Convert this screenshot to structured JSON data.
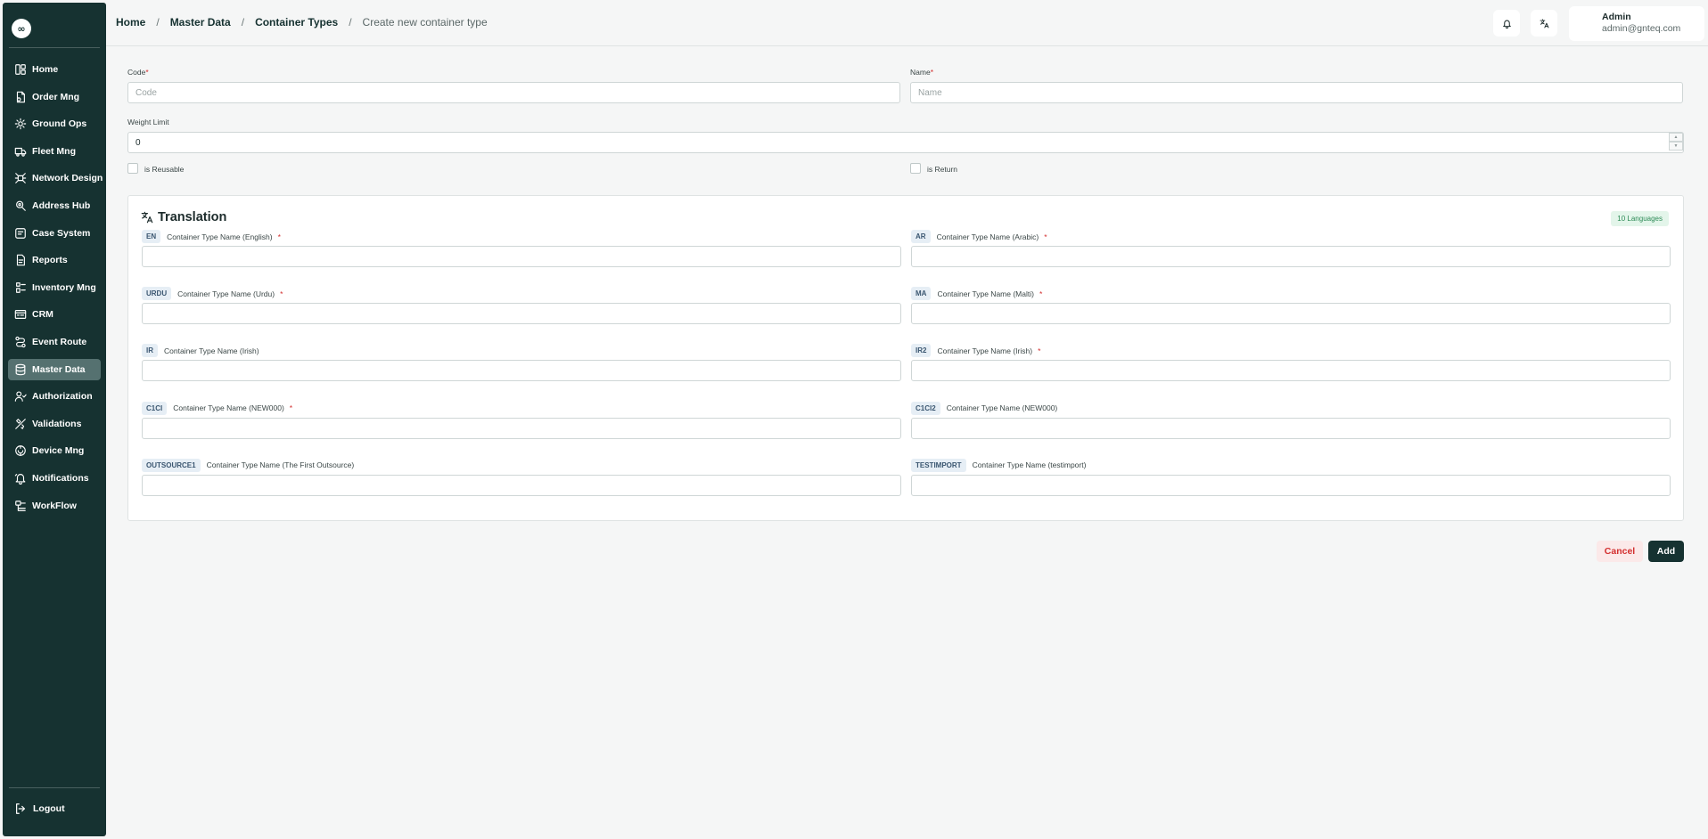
{
  "sidebar": {
    "logo_glyph": "∞",
    "items": [
      {
        "label": "Home",
        "icon": "home-icon",
        "active": false
      },
      {
        "label": "Order Mng",
        "icon": "order-icon",
        "active": false
      },
      {
        "label": "Ground Ops",
        "icon": "ground-ops-icon",
        "active": false
      },
      {
        "label": "Fleet Mng",
        "icon": "truck-icon",
        "active": false
      },
      {
        "label": "Network Design",
        "icon": "network-icon",
        "active": false
      },
      {
        "label": "Address Hub",
        "icon": "address-icon",
        "active": false
      },
      {
        "label": "Case System",
        "icon": "case-icon",
        "active": false
      },
      {
        "label": "Reports",
        "icon": "report-icon",
        "active": false
      },
      {
        "label": "Inventory Mng",
        "icon": "inventory-icon",
        "active": false
      },
      {
        "label": "CRM",
        "icon": "crm-icon",
        "active": false
      },
      {
        "label": "Event Route",
        "icon": "route-icon",
        "active": false
      },
      {
        "label": "Master Data",
        "icon": "database-icon",
        "active": true
      },
      {
        "label": "Authorization",
        "icon": "users-icon",
        "active": false
      },
      {
        "label": "Validations",
        "icon": "validations-icon",
        "active": false
      },
      {
        "label": "Device Mng",
        "icon": "device-icon",
        "active": false
      },
      {
        "label": "Notifications",
        "icon": "bell-icon",
        "active": false
      },
      {
        "label": "WorkFlow",
        "icon": "workflow-icon",
        "active": false
      }
    ],
    "logout_label": "Logout"
  },
  "header": {
    "breadcrumb": [
      "Home",
      "Master Data",
      "Container Types"
    ],
    "breadcrumb_sep": "/",
    "current_page": "Create new container type",
    "user": {
      "name": "Admin",
      "email": "admin@gnteq.com"
    }
  },
  "form": {
    "code": {
      "label": "Code",
      "required_mark": "*",
      "placeholder": "Code",
      "value": ""
    },
    "name": {
      "label": "Name",
      "required_mark": "*",
      "placeholder": "Name",
      "value": ""
    },
    "weight_limit": {
      "label": "Weight Limit",
      "value": "0"
    },
    "is_reusable": {
      "label": "is Reusable",
      "checked": false
    },
    "is_return": {
      "label": "is Return",
      "checked": false
    }
  },
  "translation": {
    "title": "Translation",
    "badge": "10 Languages",
    "fields": [
      {
        "code": "EN",
        "label": "Container Type Name (English)",
        "required": true
      },
      {
        "code": "AR",
        "label": "Container Type Name (Arabic)",
        "required": true
      },
      {
        "code": "URDU",
        "label": "Container Type Name (Urdu)",
        "required": true
      },
      {
        "code": "MA",
        "label": "Container Type Name (Malti)",
        "required": true
      },
      {
        "code": "IR",
        "label": "Container Type Name (Irish)",
        "required": false
      },
      {
        "code": "IR2",
        "label": "Container Type Name (Irish)",
        "required": true
      },
      {
        "code": "C1CI",
        "label": "Container Type Name (NEW000)",
        "required": true
      },
      {
        "code": "C1CI2",
        "label": "Container Type Name (NEW000)",
        "required": false
      },
      {
        "code": "OUTSOURCE1",
        "label": "Container Type Name (The First Outsource)",
        "required": false
      },
      {
        "code": "TESTIMPORT",
        "label": "Container Type Name (testimport)",
        "required": false
      }
    ]
  },
  "actions": {
    "cancel_label": "Cancel",
    "add_label": "Add"
  },
  "colors": {
    "sidebar_bg": "#163231",
    "active_item_bg": "#557170",
    "required": "#d32f2f",
    "badge_bg": "#e3f5ea",
    "badge_text": "#2e8b57",
    "cancel_bg": "#fbe9e9",
    "primary": "#163231"
  }
}
